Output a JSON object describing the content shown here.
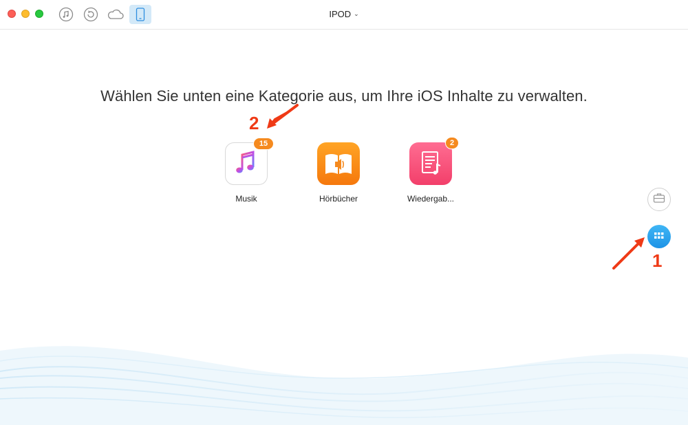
{
  "window": {
    "device_title": "IPOD",
    "toolbar_icons": [
      "music-note-icon",
      "restore-icon",
      "cloud-icon",
      "device-icon"
    ]
  },
  "main": {
    "headline": "Wählen Sie unten eine Kategorie aus, um Ihre iOS Inhalte zu verwalten.",
    "categories": [
      {
        "label": "Musik",
        "badge": "15",
        "icon": "music-icon"
      },
      {
        "label": "Hörbücher",
        "badge": "",
        "icon": "audiobook-icon"
      },
      {
        "label": "Wiedergab...",
        "badge": "2",
        "icon": "playlist-icon"
      }
    ]
  },
  "side_buttons": [
    {
      "icon": "toolkit-icon"
    },
    {
      "icon": "category-grid-icon"
    }
  ],
  "annotations": {
    "step_1": "1",
    "step_2": "2",
    "color": "#ef3a16"
  },
  "colors": {
    "accent": "#1e93e6",
    "badge": "#f58a1f"
  }
}
